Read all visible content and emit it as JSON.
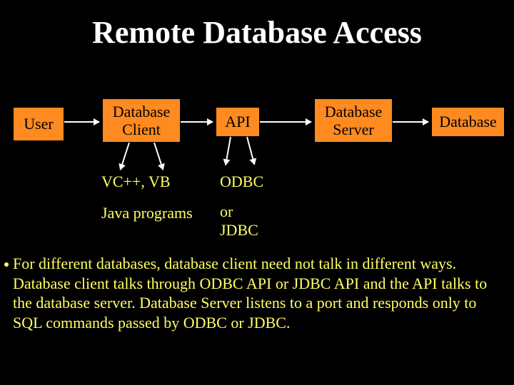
{
  "title": "Remote Database Access",
  "boxes": {
    "user": "User",
    "client": "Database\nClient",
    "api": "API",
    "server": "Database\nServer",
    "db": "Database"
  },
  "labels": {
    "vcvb": "VC++, VB",
    "javaprograms": "Java programs",
    "odbc": "ODBC",
    "orjdbc": "or\nJDBC"
  },
  "paragraph": "For different databases, database client need not talk in different ways. Database client talks through ODBC API or JDBC API and the API talks to the database server. Database Server listens to a port and responds only to SQL commands passed by ODBC or JDBC."
}
